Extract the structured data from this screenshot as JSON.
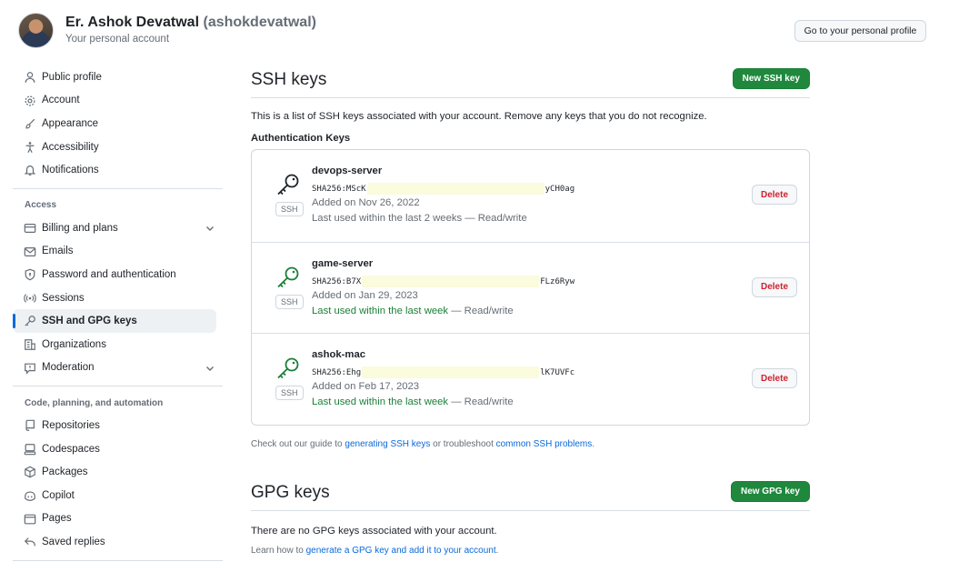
{
  "header": {
    "name": "Er. Ashok Devatwal",
    "handle": "(ashokdevatwal)",
    "subtitle": "Your personal account",
    "profile_button": "Go to your personal profile"
  },
  "sidebar": {
    "top_items": [
      {
        "label": "Public profile",
        "icon": "person-icon"
      },
      {
        "label": "Account",
        "icon": "gear-icon"
      },
      {
        "label": "Appearance",
        "icon": "paintbrush-icon"
      },
      {
        "label": "Accessibility",
        "icon": "accessibility-icon"
      },
      {
        "label": "Notifications",
        "icon": "bell-icon"
      }
    ],
    "access_label": "Access",
    "access_items": [
      {
        "label": "Billing and plans",
        "icon": "credit-card-icon"
      },
      {
        "label": "Emails",
        "icon": "mail-icon"
      },
      {
        "label": "Password and authentication",
        "icon": "shield-lock-icon"
      },
      {
        "label": "Sessions",
        "icon": "broadcast-icon"
      },
      {
        "label": "SSH and GPG keys",
        "icon": "key-icon"
      },
      {
        "label": "Organizations",
        "icon": "organization-icon"
      },
      {
        "label": "Moderation",
        "icon": "report-icon"
      }
    ],
    "code_label": "Code, planning, and automation",
    "code_items": [
      {
        "label": "Repositories",
        "icon": "repo-icon"
      },
      {
        "label": "Codespaces",
        "icon": "codespaces-icon"
      },
      {
        "label": "Packages",
        "icon": "package-icon"
      },
      {
        "label": "Copilot",
        "icon": "copilot-icon"
      },
      {
        "label": "Pages",
        "icon": "browser-icon"
      },
      {
        "label": "Saved replies",
        "icon": "reply-icon"
      }
    ]
  },
  "ssh": {
    "title": "SSH keys",
    "new_button": "New SSH key",
    "description": "This is a list of SSH keys associated with your account. Remove any keys that you do not recognize.",
    "auth_heading": "Authentication Keys",
    "badge": "SSH",
    "delete_label": "Delete",
    "keys": [
      {
        "name": "devops-server",
        "fp_start": "SHA256:MScK",
        "fp_end": "yCH0ag",
        "added": "Added on Nov 26, 2022",
        "used_recent": "",
        "used": "Last used within the last 2 weeks — Read/write",
        "icon_color": "#1f2328"
      },
      {
        "name": "game-server",
        "fp_start": "SHA256:B7X",
        "fp_end": "FLz6Ryw",
        "added": "Added on Jan 29, 2023",
        "used_recent": "Last used within the last week",
        "used": " — Read/write",
        "icon_color": "#1a7f37"
      },
      {
        "name": "ashok-mac",
        "fp_start": "SHA256:Ehg",
        "fp_end": "lK7UVFc",
        "added": "Added on Feb 17, 2023",
        "used_recent": "Last used within the last week",
        "used": " — Read/write",
        "icon_color": "#1a7f37"
      }
    ],
    "note_prefix": "Check out our guide to ",
    "note_link1": "generating SSH keys",
    "note_mid": " or troubleshoot ",
    "note_link2": "common SSH problems",
    "note_suffix": "."
  },
  "gpg": {
    "title": "GPG keys",
    "new_button": "New GPG key",
    "description": "There are no GPG keys associated with your account.",
    "learn_prefix": "Learn how to ",
    "learn_link": "generate a GPG key and add it to your account",
    "learn_suffix": "."
  },
  "colors": {
    "accent": "#0969da",
    "primary": "#1f883d",
    "danger": "#cf222e"
  }
}
